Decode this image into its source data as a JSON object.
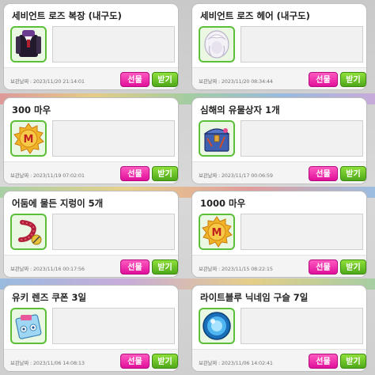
{
  "cards": [
    {
      "title": "세비언트 로즈 복장 (내구도)",
      "date_label": "보관날짜 :",
      "date": "2023/11/20 21:14:01",
      "gift_label": "선물",
      "receive_label": "받기",
      "icon": "black-suit-outfit-icon"
    },
    {
      "title": "세비언트 로즈 헤어 (내구도)",
      "date_label": "보관날짜 :",
      "date": "2023/11/20 08:34:44",
      "gift_label": "선물",
      "receive_label": "받기",
      "icon": "white-hair-icon"
    },
    {
      "title": "300 마우",
      "date_label": "보관날짜 :",
      "date": "2023/11/19 07:02:01",
      "gift_label": "선물",
      "receive_label": "받기",
      "icon": "mau-coin-icon"
    },
    {
      "title": "심해의 유물상자 1개",
      "date_label": "보관날짜 :",
      "date": "2023/11/17 00:06:59",
      "gift_label": "선물",
      "receive_label": "받기",
      "icon": "treasure-box-icon"
    },
    {
      "title": "어둠에 물든 지렁이 5개",
      "date_label": "보관날짜 :",
      "date": "2023/11/16 00:17:56",
      "gift_label": "선물",
      "receive_label": "받기",
      "icon": "worm-icon"
    },
    {
      "title": "1000 마우",
      "date_label": "보관날짜 :",
      "date": "2023/11/15 08:22:15",
      "gift_label": "선물",
      "receive_label": "받기",
      "icon": "mau-coin-icon"
    },
    {
      "title": "유키 렌즈 쿠폰 3일",
      "date_label": "보관날짜 :",
      "date": "2023/11/06 14:08:13",
      "gift_label": "선물",
      "receive_label": "받기",
      "icon": "lens-coupon-icon"
    },
    {
      "title": "라이트블루 닉네임 구슬 7일",
      "date_label": "보관날짜 :",
      "date": "2023/11/06 14:02:41",
      "gift_label": "선물",
      "receive_label": "받기",
      "icon": "blue-orb-icon"
    }
  ]
}
